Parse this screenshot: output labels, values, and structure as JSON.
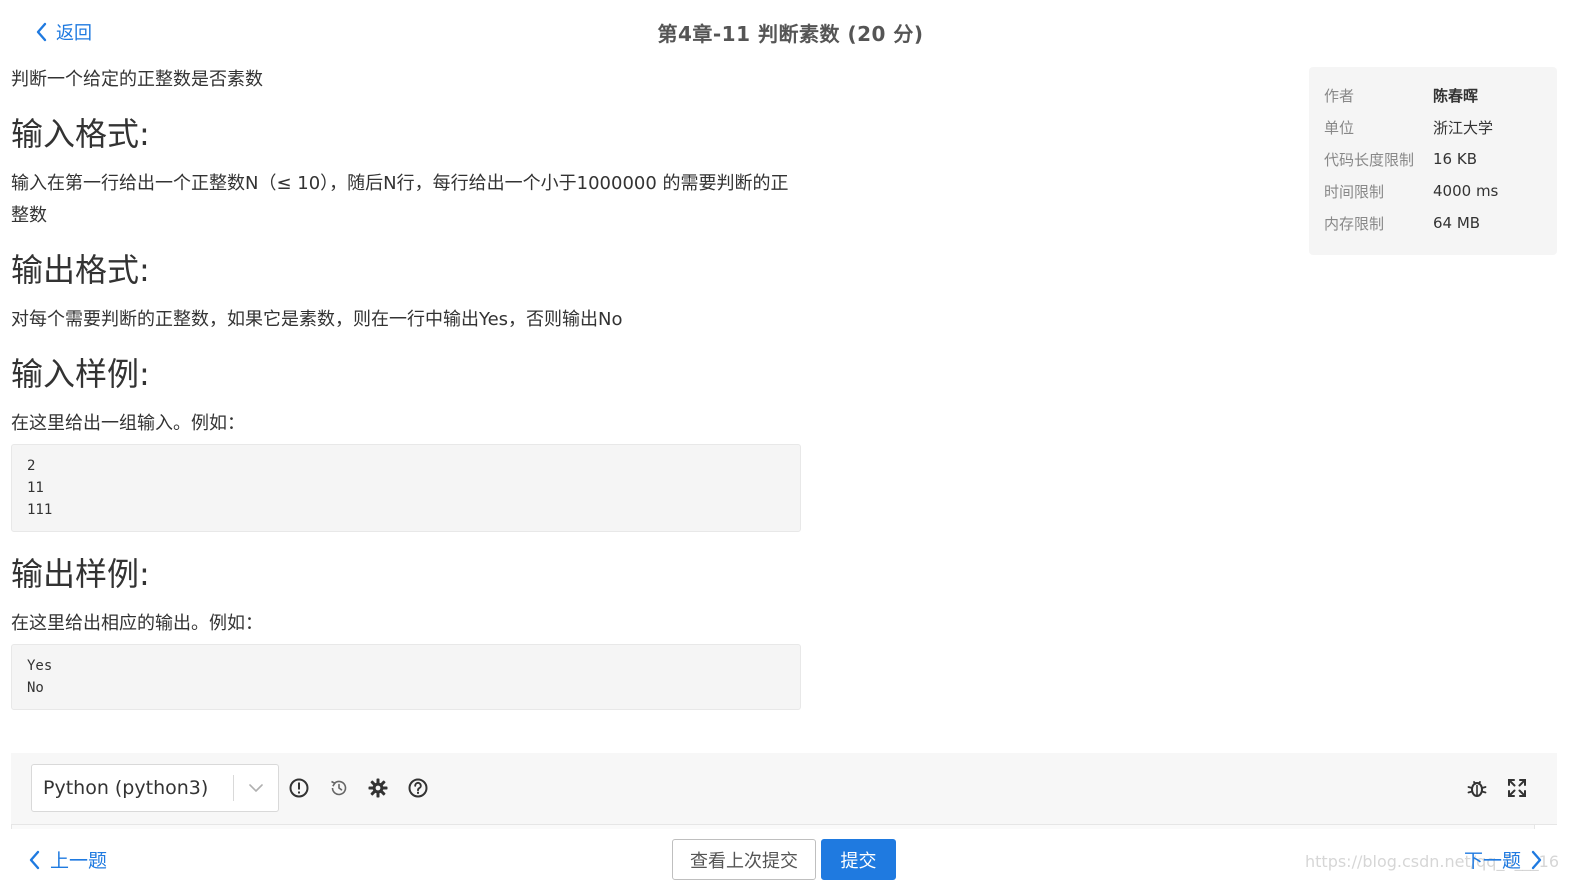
{
  "header": {
    "back_label": "返回",
    "title": "第4章-11 判断素数 (20 分)"
  },
  "problem": {
    "description": "判断一个给定的正整数是否素数",
    "input_heading": "输入格式:",
    "input_text": "输入在第一行给出一个正整数N（≤ 10），随后N行，每行给出一个小于1000000 的需要判断的正整数",
    "output_heading": "输出格式:",
    "output_text": "对每个需要判断的正整数，如果它是素数，则在一行中输出Yes，否则输出No",
    "sample_input_heading": "输入样例:",
    "sample_input_intro": "在这里给出一组输入。例如：",
    "sample_input_lines": [
      "2",
      "11",
      "111"
    ],
    "sample_output_heading": "输出样例:",
    "sample_output_intro": "在这里给出相应的输出。例如：",
    "sample_output_lines": [
      "Yes",
      "No"
    ]
  },
  "meta": [
    {
      "key": "作者",
      "value": "陈春晖"
    },
    {
      "key": "单位",
      "value": "浙江大学"
    },
    {
      "key": "代码长度限制",
      "value": "16 KB"
    },
    {
      "key": "时间限制",
      "value": "4000 ms"
    },
    {
      "key": "内存限制",
      "value": "64 MB"
    }
  ],
  "editor": {
    "language": "Python (python3)",
    "icons": [
      "info-icon",
      "history-icon",
      "settings-icon",
      "help-icon",
      "debug-icon",
      "fullscreen-icon"
    ]
  },
  "footer": {
    "prev_label": "上一题",
    "next_label": "下一题",
    "history_button": "查看上次提交",
    "submit_button": "提交",
    "watermark": "https://blog.csdn.net/qq_5___16"
  },
  "colors": {
    "accent": "#1f7ae0",
    "panel_bg": "#f5f5f5",
    "text": "#333333"
  }
}
